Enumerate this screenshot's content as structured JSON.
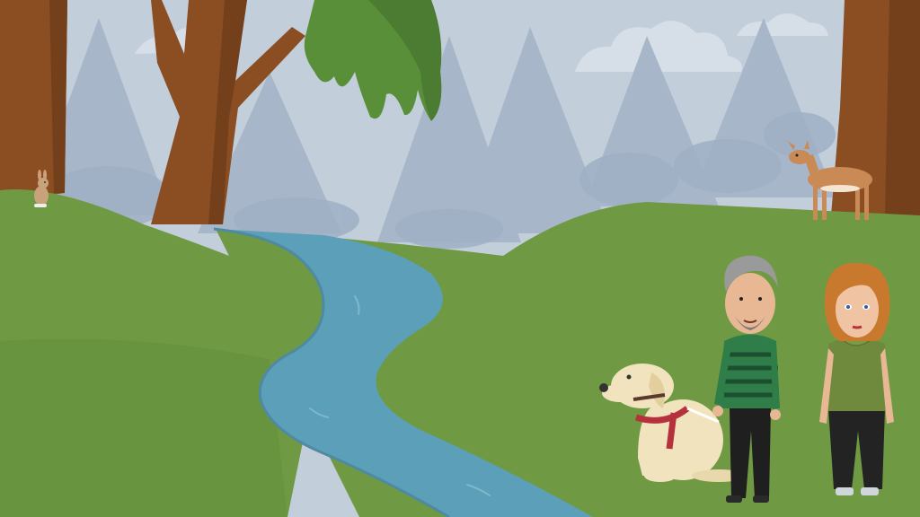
{
  "scene": {
    "setting": "forest",
    "elements": [
      "sky",
      "pine-trees",
      "clouds",
      "tree-trunks",
      "hanging-moss",
      "river",
      "grass-hills",
      "rabbit",
      "deer",
      "guide-dog",
      "man",
      "woman"
    ]
  },
  "colors": {
    "sky": "#c3cedb",
    "distant_trees": "#a7b6c9",
    "grass": "#6f9a43",
    "grass_dark": "#5e8838",
    "river": "#5c9fb8",
    "bark": "#8a4e22",
    "moss": "#5a8f3a",
    "man_shirt": "#2f7d49",
    "woman_shirt": "#6f8a3c",
    "dog": "#f1e3bd",
    "harness": "#b5323d"
  }
}
